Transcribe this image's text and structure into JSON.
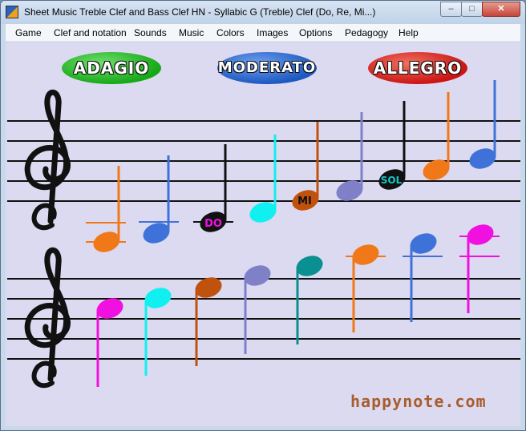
{
  "window": {
    "title": "Sheet Music Treble Clef and Bass Clef HN - Syllabic G (Treble) Clef (Do, Re, Mi...)",
    "buttons": {
      "minimize": "–",
      "maximize": "□",
      "close": "✕"
    }
  },
  "menu": [
    "Game",
    "Clef and notation",
    "Sounds",
    "Music",
    "Colors",
    "Images",
    "Options",
    "Pedagogy",
    "Help"
  ],
  "tempo": {
    "adagio": "ADAGIO",
    "moderato": "MODERATO",
    "allegro": "ALLEGRO"
  },
  "note_labels": {
    "do": "DO",
    "mi": "MI",
    "sol": "SOL"
  },
  "watermark": "happynote.com",
  "note_colors": {
    "orange": "#f07818",
    "blue": "#3f72d8",
    "black": "#111111",
    "cyan": "#10f0f0",
    "brown": "#c0520e",
    "lavender": "#8080c8",
    "teal": "#0a9090",
    "magenta": "#f010e0"
  },
  "icons": {
    "treble_clef": "treble-clef-icon"
  }
}
